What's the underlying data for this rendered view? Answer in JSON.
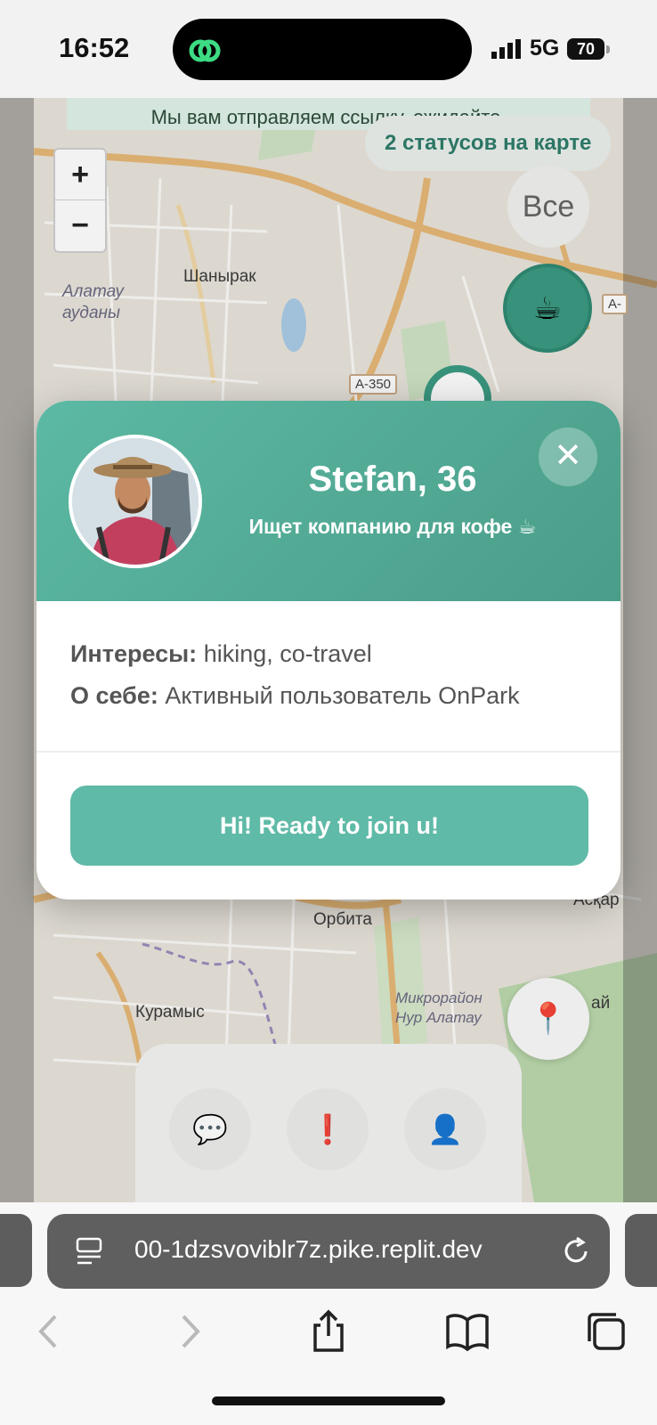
{
  "status_bar": {
    "time": "16:52",
    "network": "5G",
    "battery": "70"
  },
  "map": {
    "notice": "Мы вам отправляем ссылку, ожидайте.",
    "status_chip": "2 статусов на карте",
    "zoom_in": "+",
    "zoom_out": "−",
    "filter_all": "Все",
    "labels": {
      "shanyrak": "Шанырак",
      "alatau": "Алатау\nауданы",
      "orbita": "Орбита",
      "kuramys": "Курамыс",
      "nur_alatau": "Микрорайон\nНур Алатау",
      "askar": "Асқар",
      "ai": "ай",
      "a350": "А-350",
      "a": "А-"
    },
    "markers": {
      "coffee_icon": "☕"
    },
    "location_pin_icon": "📍",
    "nav": {
      "chat_icon": "💬",
      "alert_icon": "❗",
      "profile_icon": "👤"
    }
  },
  "profile_card": {
    "name": "Stefan, 36",
    "status": "Ищет компанию для кофе ☕",
    "close_label": "✕",
    "interests_label": "Интересы:",
    "interests_value": "hiking, co-travel",
    "about_label": "О себе:",
    "about_value": "Активный пользователь OnPark",
    "cta_label": "Hi! Ready to join u!"
  },
  "browser": {
    "url": "00-1dzsvoviblr7z.pike.replit.dev"
  },
  "colors": {
    "accent": "#5fbaa7",
    "header": "#4a9d89",
    "marker": "#3c9a82"
  }
}
